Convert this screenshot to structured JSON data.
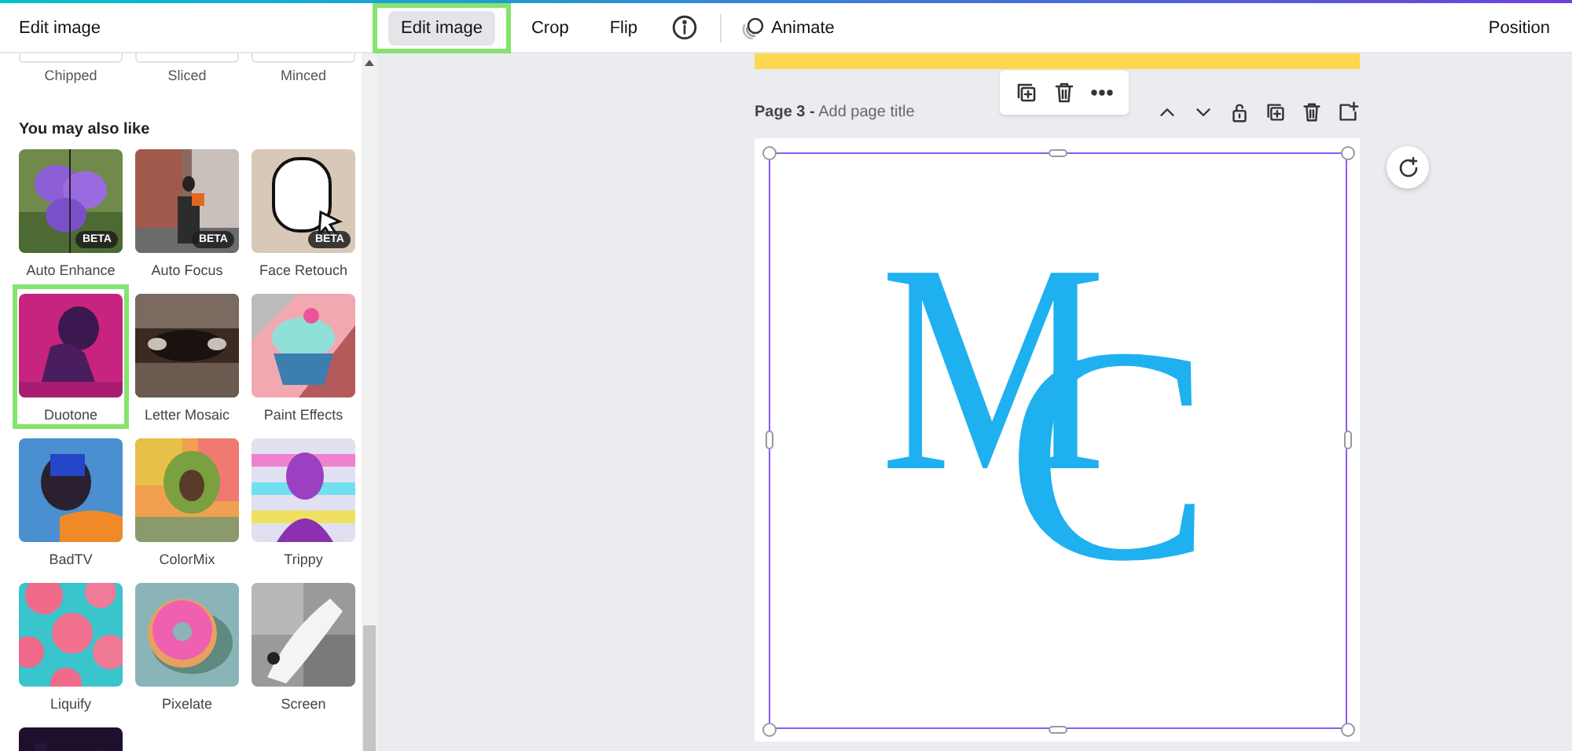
{
  "top_bar": {
    "panel_title": "Edit image",
    "tools": [
      {
        "kind": "button",
        "label": "Edit image",
        "selected": true,
        "highlighted": true
      },
      {
        "kind": "button",
        "label": "Crop",
        "selected": false,
        "highlighted": false
      },
      {
        "kind": "button",
        "label": "Flip",
        "selected": false,
        "highlighted": false
      },
      {
        "kind": "info"
      },
      {
        "kind": "animate",
        "label": "Animate"
      }
    ],
    "position": "Position"
  },
  "panel": {
    "previous_effects": [
      "Chipped",
      "Sliced",
      "Minced"
    ],
    "heading": "You may also like",
    "effects": [
      {
        "kind": "picture",
        "label": "Auto Enhance",
        "badge": "BETA",
        "highlighted": false
      },
      {
        "kind": "picture",
        "label": "Auto Focus",
        "badge": "BETA",
        "highlighted": false
      },
      {
        "kind": "picture",
        "label": "Face Retouch",
        "badge": "BETA",
        "highlighted": false
      },
      {
        "kind": "picture",
        "label": "Duotone",
        "highlighted": true
      },
      {
        "kind": "picture",
        "label": "Letter Mosaic",
        "highlighted": false
      },
      {
        "kind": "picture",
        "label": "Paint Effects",
        "highlighted": false
      },
      {
        "kind": "picture",
        "label": "BadTV",
        "highlighted": false
      },
      {
        "kind": "picture",
        "label": "ColorMix",
        "highlighted": false
      },
      {
        "kind": "picture",
        "label": "Trippy",
        "highlighted": false
      },
      {
        "kind": "picture",
        "label": "Liquify",
        "highlighted": false
      },
      {
        "kind": "picture",
        "label": "Pixelate",
        "highlighted": false
      },
      {
        "kind": "picture",
        "label": "Screen",
        "highlighted": false
      },
      {
        "kind": "picture",
        "highlighted": false
      }
    ]
  },
  "page": {
    "number": "Page 3 -",
    "title_placeholder": "Add page title",
    "logo": [
      "M",
      "C"
    ]
  }
}
